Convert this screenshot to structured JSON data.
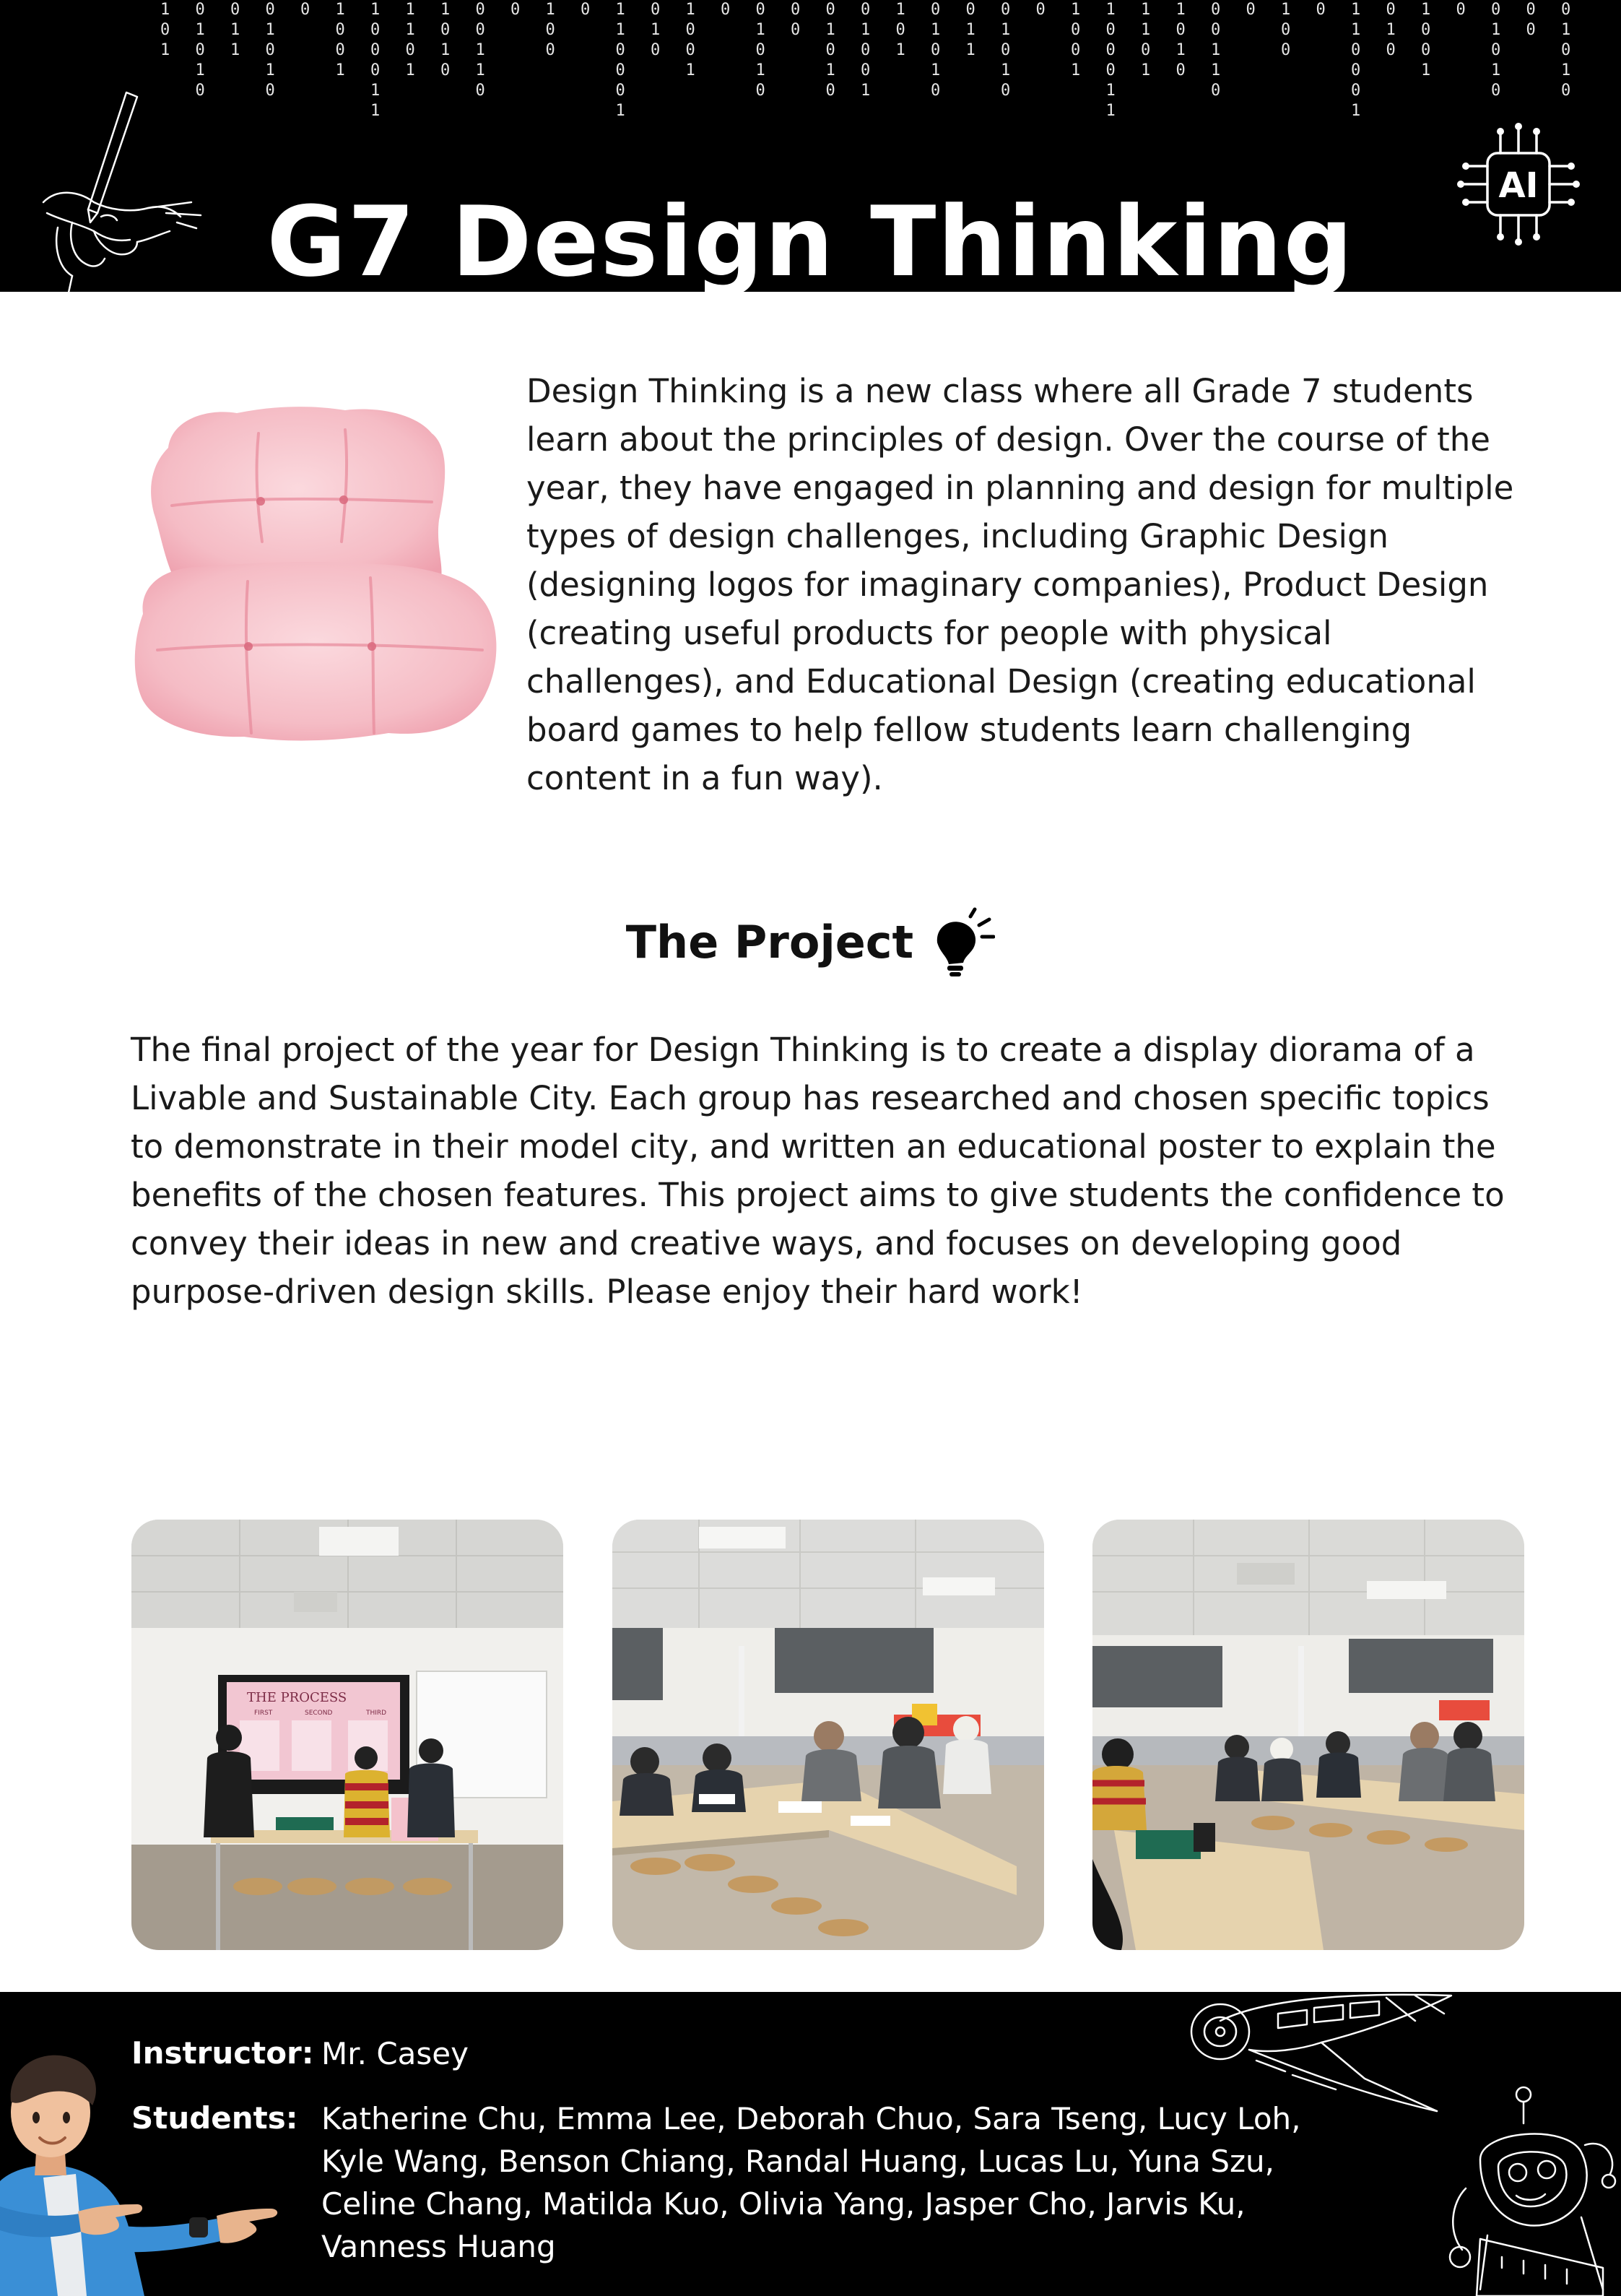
{
  "header": {
    "title": "G7 Design Thinking",
    "binary_columns": [
      "1\n0\n1",
      "0\n1\n0\n1\n0",
      "0\n1\n1",
      "0\n1\n0\n1\n0",
      "0",
      "1\n0\n0\n1",
      "1\n0\n0\n0\n1\n1",
      "1\n1\n0\n1",
      "1\n0\n1\n0",
      "0\n0\n1\n1\n0",
      "0",
      "1\n0\n0",
      "0",
      "1\n1\n0\n0\n0\n1",
      "0\n1\n0",
      "1\n0\n0\n1",
      "0",
      "0\n1\n0\n1\n0",
      "0\n0",
      "0\n1\n0\n1\n0",
      "0\n1\n0\n0\n1",
      "1\n0\n1",
      "0\n1\n0\n1\n0",
      "0\n1\n1",
      "0\n1\n0\n1\n0",
      "0",
      "1\n0\n0\n1",
      "1\n0\n0\n0\n1\n1",
      "1\n1\n0\n1",
      "1\n0\n1\n0",
      "0\n0\n1\n1\n0",
      "0",
      "1\n0\n0",
      "0",
      "1\n1\n0\n0\n0\n1",
      "0\n1\n0",
      "1\n0\n0\n1",
      "0",
      "0\n1\n0\n1\n0",
      "0\n0",
      "0\n1\n0\n1\n0"
    ],
    "binary_color": "#e6e6e6",
    "hand_icon": "pen-hand-icon",
    "chip_icon": "ai-chip-icon",
    "chip_label": "AI"
  },
  "intro": {
    "image_icon": "pink-cushion-chair",
    "text": "Design Thinking is a new class where all Grade 7 students learn about the principles of design. Over the course of the year, they have engaged in planning and design for multiple types of design challenges, including Graphic Design (designing logos for imaginary companies), Product Design (creating useful products for people with physical challenges), and Educational Design (creating educational board games to help fellow students learn challenging content in a fun way)."
  },
  "project": {
    "heading": "The Project",
    "icon": "lightbulb-icon",
    "text": "The final project of the year for Design Thinking is to create a display diorama of a Livable and Sustainable City. Each group has researched and chosen specific topics to demonstrate in their model city, and written an educational poster to explain the benefits of the chosen features. This project aims to give students the confidence to convey their ideas in new and creative ways, and focuses on developing good purpose-driven design skills. Please enjoy their hard work!"
  },
  "photos": [
    {
      "slide_title": "THE PROCESS",
      "slide_cols": [
        "FIRST",
        "SECOND",
        "THIRD"
      ]
    },
    {
      "slide_title": "",
      "slide_cols": []
    },
    {
      "slide_title": "",
      "slide_cols": []
    }
  ],
  "footer": {
    "instructor_label": "Instructor:",
    "instructor_name": "Mr. Casey",
    "students_label": "Students:",
    "students_names": "Katherine Chu, Emma Lee, Deborah Chuo, Sara Tseng, Lucy Loh, Kyle Wang, Benson Chiang, Randal Huang, Lucas Lu, Yuna Szu, Celine Chang, Matilda Kuo, Olivia Yang, Jasper Cho, Jarvis Ku, Vanness Huang",
    "person_icon": "pointing-person-icon",
    "airplane_icon": "airplane-icon",
    "robot_icon": "robot-icon"
  },
  "colors": {
    "band_black": "#000000",
    "page_white": "#ffffff",
    "cushion_pink": "#f4b9c2",
    "text_dark": "#1a1a1a"
  }
}
